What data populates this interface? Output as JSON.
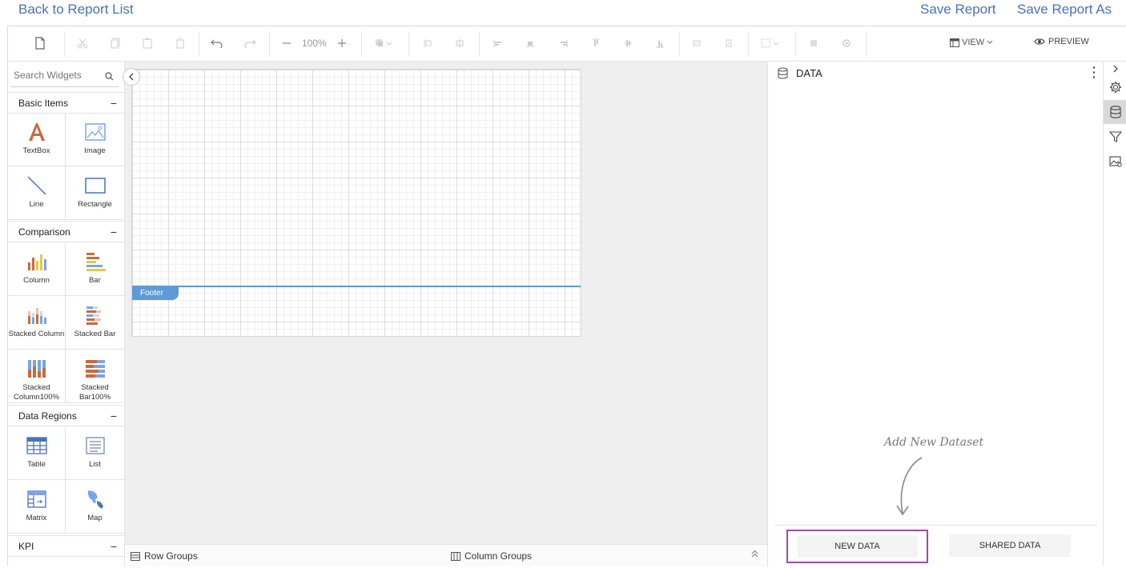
{
  "top_links": {
    "back": "Back to Report List",
    "save": "Save Report",
    "save_as": "Save Report As"
  },
  "toolbar": {
    "zoom": "100%",
    "view_label": "VIEW",
    "preview_label": "PREVIEW"
  },
  "widgets": {
    "search_placeholder": "Search Widgets",
    "categories": [
      {
        "name": "Basic Items",
        "items": [
          "TextBox",
          "Image",
          "Line",
          "Rectangle"
        ]
      },
      {
        "name": "Comparison",
        "items": [
          "Column",
          "Bar",
          "Stacked Column",
          "Stacked Bar",
          "Stacked Column100%",
          "Stacked Bar100%"
        ]
      },
      {
        "name": "Data Regions",
        "items": [
          "Table",
          "List",
          "Matrix",
          "Map"
        ]
      },
      {
        "name": "KPI",
        "items": []
      }
    ]
  },
  "canvas": {
    "footer_label": "Footer"
  },
  "groups": {
    "row_groups": "Row Groups",
    "column_groups": "Column Groups"
  },
  "data_panel": {
    "title": "DATA",
    "hint": "Add New Dataset",
    "new_data": "NEW DATA",
    "shared_data": "SHARED DATA"
  },
  "colors": {
    "link": "#4a72b8",
    "footer_band": "#5e9ad6",
    "highlight_border": "#9b4ea7",
    "chart_orange": "#c96a3c",
    "chart_yellow": "#e6c84d",
    "chart_blue": "#7ba4e6"
  }
}
